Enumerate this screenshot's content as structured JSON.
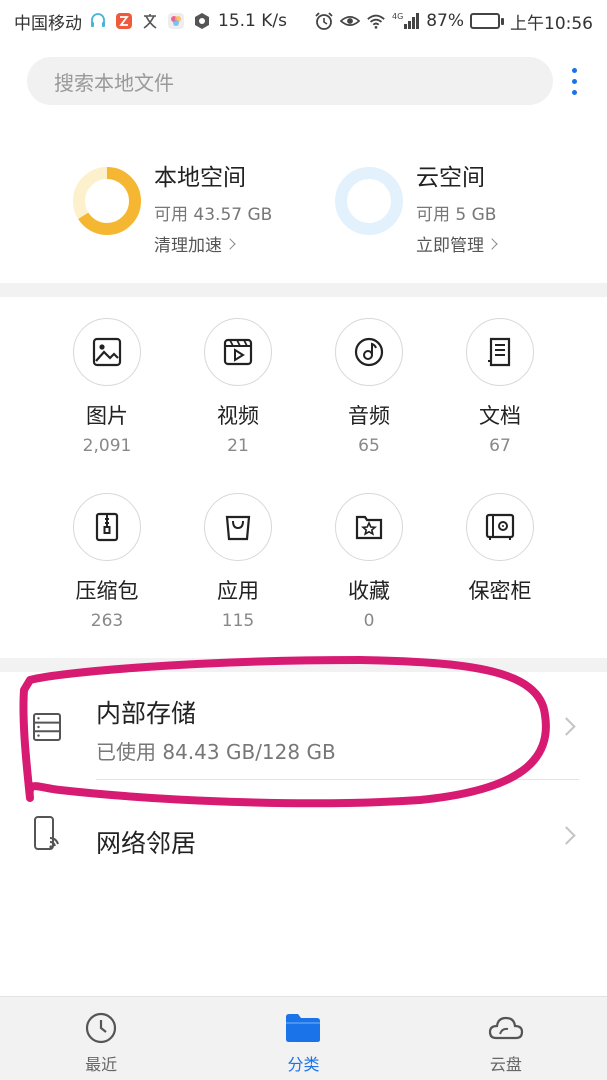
{
  "status_bar": {
    "carrier": "中国移动",
    "speed": "15.1 K/s",
    "network": "4G",
    "battery": "87%",
    "battery_level": 0.87,
    "time": "上午10:56"
  },
  "search": {
    "placeholder": "搜索本地文件"
  },
  "storage": {
    "local": {
      "title": "本地空间",
      "available": "可用 43.57 GB",
      "action": "清理加速",
      "used_fraction": 0.66,
      "color": "#f5b731"
    },
    "cloud": {
      "title": "云空间",
      "available": "可用 5 GB",
      "action": "立即管理",
      "color": "#e3f1fc"
    }
  },
  "categories": [
    {
      "label": "图片",
      "count": "2,091",
      "icon": "image-icon"
    },
    {
      "label": "视频",
      "count": "21",
      "icon": "video-icon"
    },
    {
      "label": "音频",
      "count": "65",
      "icon": "audio-icon"
    },
    {
      "label": "文档",
      "count": "67",
      "icon": "document-icon"
    },
    {
      "label": "压缩包",
      "count": "263",
      "icon": "archive-icon"
    },
    {
      "label": "应用",
      "count": "115",
      "icon": "app-bag-icon"
    },
    {
      "label": "收藏",
      "count": "0",
      "icon": "favorite-icon"
    },
    {
      "label": "保密柜",
      "count": "",
      "icon": "safe-icon"
    }
  ],
  "locations": {
    "internal": {
      "title": "内部存储",
      "usage": "已使用 84.43 GB/128 GB"
    },
    "network": {
      "title": "网络邻居"
    }
  },
  "bottom_nav": [
    {
      "label": "最近",
      "icon": "clock-icon"
    },
    {
      "label": "分类",
      "icon": "folder-icon",
      "active": true
    },
    {
      "label": "云盘",
      "icon": "cloud-icon"
    }
  ],
  "colors": {
    "accent": "#1a73e8",
    "annotation": "#d81b72"
  }
}
